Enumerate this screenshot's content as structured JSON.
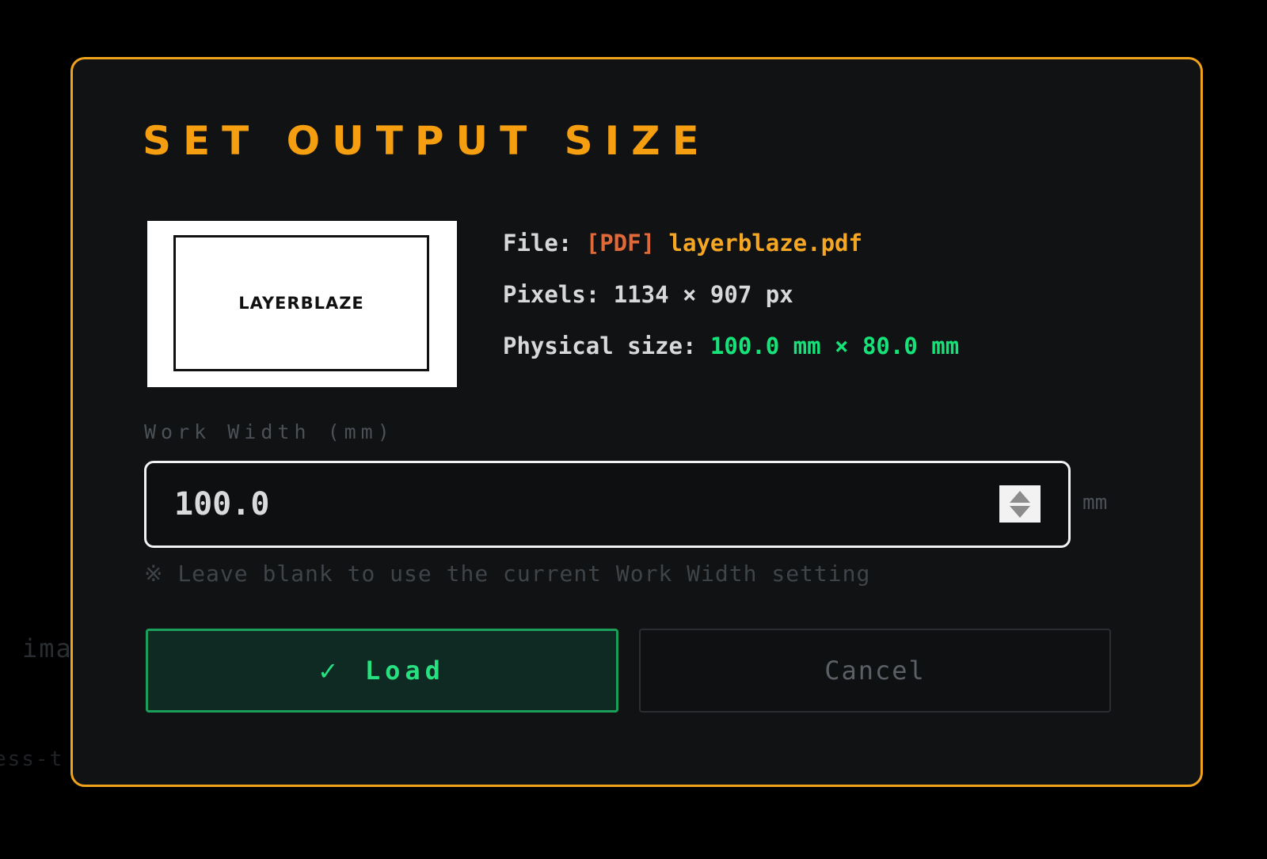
{
  "background": {
    "fragment_one": "ima",
    "fragment_two": "ess-t"
  },
  "dialog": {
    "title": "SET OUTPUT SIZE",
    "preview_logo": "LAYERBLAZE",
    "file_label": "File: ",
    "file_tag": "[PDF]",
    "file_name": "layerblaze.pdf",
    "pixels_label": "Pixels: ",
    "pixels_value": "1134 × 907 px",
    "physical_label": "Physical size: ",
    "physical_value": "100.0 mm × 80.0 mm",
    "work_width_label": "Work Width (mm)",
    "work_width_value": "100.0",
    "unit": "mm",
    "hint": "※ Leave blank to use the current Work Width setting",
    "load_check": "✓",
    "load_label": "Load",
    "cancel_label": "Cancel"
  },
  "colors": {
    "accent": "#f0a21a",
    "green": "#17e27a",
    "pdf_tag": "#e0693a",
    "background": "#101214"
  }
}
